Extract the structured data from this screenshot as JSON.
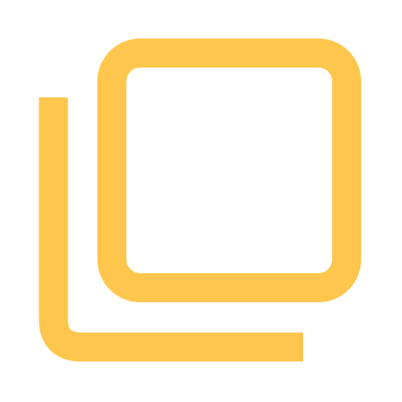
{
  "icon": {
    "name": "copy-icon",
    "color": "#FFC64D",
    "background": "#FFFFFF"
  }
}
